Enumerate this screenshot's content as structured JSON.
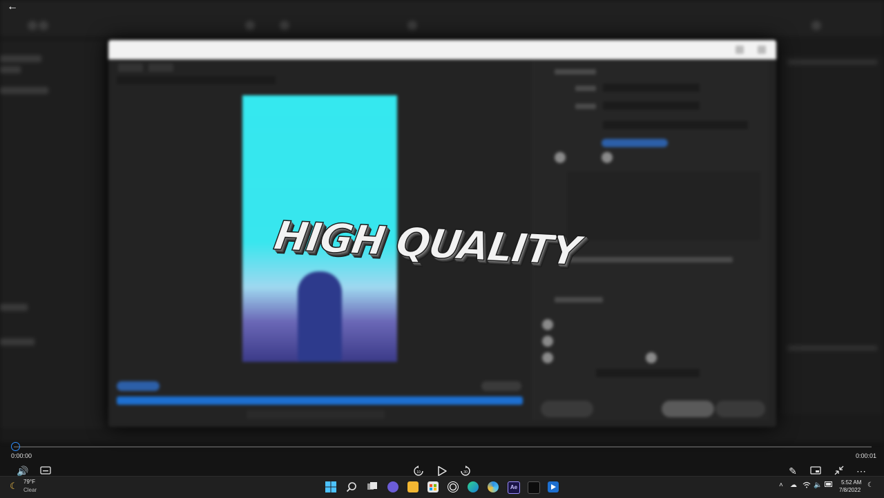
{
  "player": {
    "title_overlay": "HIGH QUALITY",
    "current_time": "0:00:00",
    "end_time": "0:00:01",
    "progress": 0.0,
    "back_icon": "arrow-left-icon",
    "controls": [
      "volume-icon",
      "captions-icon",
      "rewind-10-icon",
      "play-icon",
      "forward-30-icon",
      "edit-icon",
      "miniplayer-icon",
      "fullscreen-exit-icon",
      "more-icon"
    ],
    "rewind_label": "10",
    "forward_label": "30",
    "accent": "#2f8fff"
  },
  "taskbar": {
    "weather_temp": "79°F",
    "weather_condition": "Clear",
    "clock_time": "5:52 AM",
    "clock_date": "7/8/2022",
    "apps": [
      "windows-start-icon",
      "search-icon",
      "task-view-icon",
      "chat-icon",
      "file-explorer-icon",
      "store-icon",
      "obs-icon",
      "edge-icon",
      "browser-icon",
      "after-effects-icon",
      "terminal-icon",
      "media-player-icon"
    ],
    "after_effects_label": "Ae",
    "tray": [
      "chevron-up-icon",
      "cloud-icon",
      "wifi-icon",
      "speaker-icon",
      "battery-icon",
      "notification-icon"
    ]
  },
  "dialog": {
    "preview_colors": {
      "sky": "#38e6ee",
      "figure": "#2d3a8c",
      "timeline": "#1d6fd0"
    }
  }
}
